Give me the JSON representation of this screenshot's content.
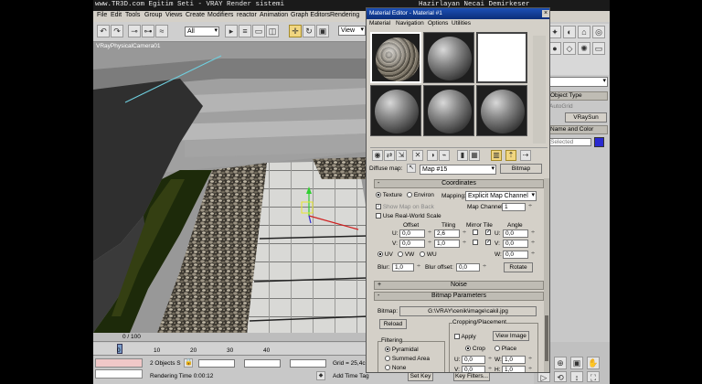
{
  "titlebar": {
    "left": "www.TR3D.com Egitim Seti -  VRAY Render sistemi",
    "right": "Hazirlayan Necai Demirkeser"
  },
  "menu": [
    "File",
    "Edit",
    "Tools",
    "Group",
    "Views",
    "Create",
    "Modifiers",
    "reactor",
    "Animation",
    "Graph Editors",
    "Rendering"
  ],
  "toolbar": {
    "selection_filter": "All",
    "view_dropdown": "View"
  },
  "viewport": {
    "label": "VRayPhysicalCamera01"
  },
  "timeline": {
    "frame_counter": "0 / 100",
    "ticks": [
      "0",
      "10",
      "20",
      "30",
      "40"
    ],
    "status_selected": "2 Objects S",
    "rendering_time": "Rendering Time  0:00:12",
    "grid": "Grid = 25,4c",
    "add_time_tag": "Add Time Tag",
    "set_key": "Set Key",
    "key_filters": "Key Filters..."
  },
  "command_panel": {
    "object_type_title": "Object Type",
    "autogrid": "AutoGrid",
    "vraysun": "VRaySun",
    "name_color_title": "Name and Color",
    "name_value": "Selected"
  },
  "material_editor": {
    "title": "Material Editor - Material #1",
    "menu": [
      "Material",
      "Navigation",
      "Options",
      "Utilities"
    ],
    "map_label": "Diffuse map:",
    "map_name": "Map #15",
    "map_type": "Bitmap",
    "coordinates": {
      "title": "Coordinates",
      "texture": "Texture",
      "environ": "Environ",
      "mapping_label": "Mapping:",
      "mapping_value": "Explicit Map Channel",
      "show_map_on_back": "Show Map on Back",
      "map_channel_label": "Map Channel:",
      "map_channel_value": "1",
      "real_world_scale": "Use Real-World Scale",
      "offset_header": "Offset",
      "tiling_header": "Tiling",
      "mirror_tile_header": "Mirror Tile",
      "angle_header": "Angle",
      "u_label": "U:",
      "v_label": "V:",
      "w_label": "W:",
      "u_offset": "0,0",
      "v_offset": "0,0",
      "u_tiling": "2,6",
      "v_tiling": "1,0",
      "u_angle": "0,0",
      "v_angle": "0,0",
      "w_angle": "0,0",
      "uv": "UV",
      "vw": "VW",
      "wu": "WU",
      "blur_label": "Blur:",
      "blur_value": "1,0",
      "blur_offset_label": "Blur offset:",
      "blur_offset_value": "0,0",
      "rotate": "Rotate"
    },
    "noise_title": "Noise",
    "bitmap_params": {
      "title": "Bitmap Parameters",
      "bitmap_label": "Bitmap:",
      "bitmap_path": "G:\\VRAY\\cenik\\image\\cakil.jpg",
      "reload": "Reload",
      "cropping_title": "Cropping/Placement",
      "apply": "Apply",
      "view_image": "View Image",
      "crop": "Crop",
      "place": "Place",
      "filtering_title": "Filtering",
      "pyramidal": "Pyramidal",
      "summed_area": "Summed Area",
      "none": "None",
      "u_label": "U:",
      "v_label": "V:",
      "w_label": "W:",
      "h_label": "H:",
      "u_value": "0,0",
      "v_value": "0,0",
      "w_value": "1,0",
      "h_value": "1,0"
    }
  }
}
